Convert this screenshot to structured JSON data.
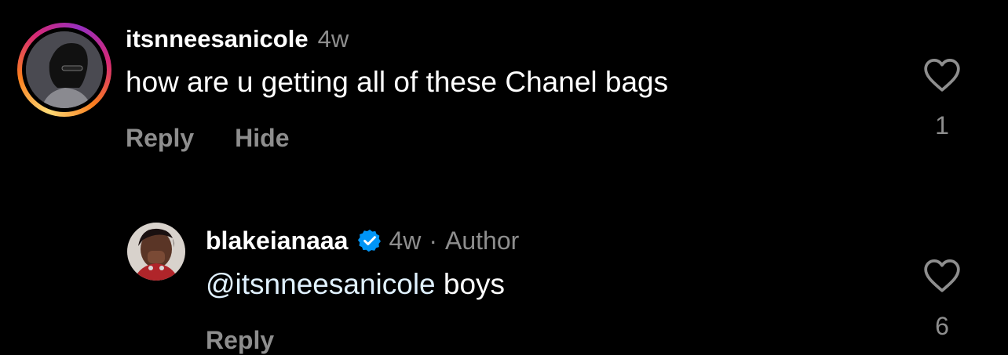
{
  "comments": [
    {
      "username": "itsnneesanicole",
      "age": "4w",
      "text": "how are u getting all of these Chanel bags",
      "reply_label": "Reply",
      "hide_label": "Hide",
      "like_count": "1",
      "avatar": "profile-photo-avatar",
      "has_story_ring": true
    },
    {
      "username": "blakeianaaa",
      "verified": true,
      "age": "4w",
      "separator": "·",
      "role": "Author",
      "mention": "@itsnneesanicole",
      "text_after_mention": " boys",
      "reply_label": "Reply",
      "like_count": "6",
      "avatar": "profile-photo-avatar"
    }
  ],
  "colors": {
    "background": "#000000",
    "primary_text": "#ffffff",
    "secondary_text": "#8e8e8e",
    "verified_badge": "#0095f6",
    "story_ring": [
      "#feda75",
      "#fa7e1e",
      "#d62976",
      "#962fbf"
    ]
  },
  "icons": [
    "heart-outline-icon",
    "verified-badge-icon"
  ]
}
